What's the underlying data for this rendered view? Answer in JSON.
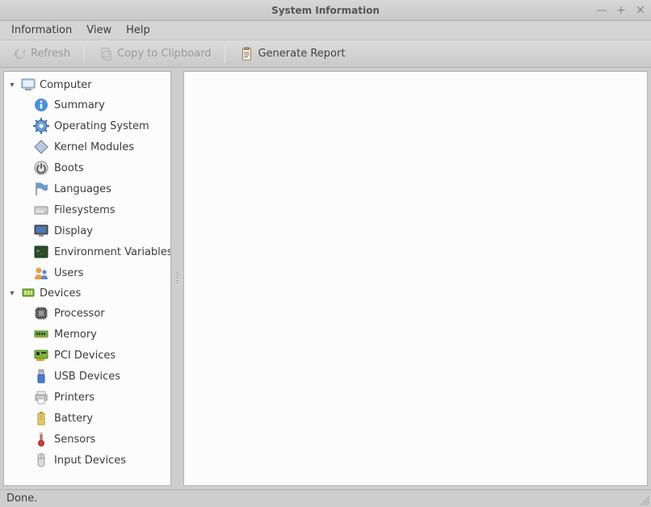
{
  "window": {
    "title": "System Information"
  },
  "menus": {
    "information": "Information",
    "view": "View",
    "help": "Help"
  },
  "toolbar": {
    "refresh": "Refresh",
    "copy": "Copy to Clipboard",
    "report": "Generate Report"
  },
  "tree": {
    "computer": {
      "label": "Computer",
      "items": [
        {
          "label": "Summary",
          "icon": "info"
        },
        {
          "label": "Operating System",
          "icon": "gear"
        },
        {
          "label": "Kernel Modules",
          "icon": "diamond"
        },
        {
          "label": "Boots",
          "icon": "power"
        },
        {
          "label": "Languages",
          "icon": "flag"
        },
        {
          "label": "Filesystems",
          "icon": "drive"
        },
        {
          "label": "Display",
          "icon": "display"
        },
        {
          "label": "Environment Variables",
          "icon": "terminal"
        },
        {
          "label": "Users",
          "icon": "users"
        }
      ]
    },
    "devices": {
      "label": "Devices",
      "items": [
        {
          "label": "Processor",
          "icon": "cpu"
        },
        {
          "label": "Memory",
          "icon": "ram"
        },
        {
          "label": "PCI Devices",
          "icon": "pci"
        },
        {
          "label": "USB Devices",
          "icon": "usb"
        },
        {
          "label": "Printers",
          "icon": "printer"
        },
        {
          "label": "Battery",
          "icon": "battery"
        },
        {
          "label": "Sensors",
          "icon": "sensor"
        },
        {
          "label": "Input Devices",
          "icon": "mouse"
        }
      ]
    }
  },
  "status": "Done."
}
